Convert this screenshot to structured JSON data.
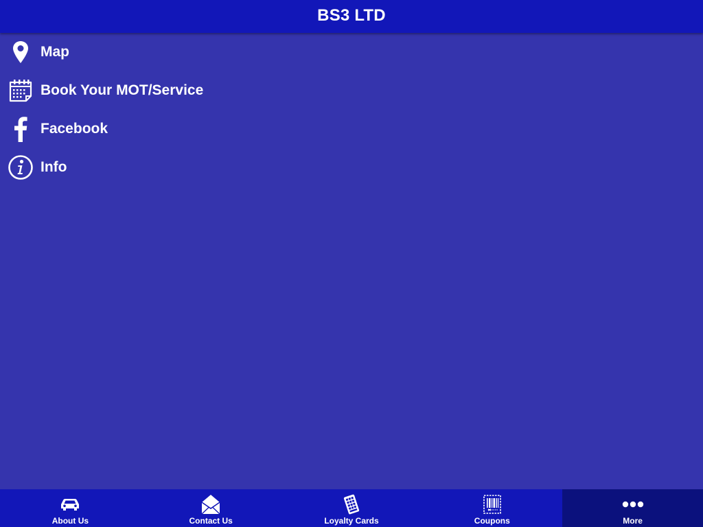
{
  "header": {
    "title": "BS3 LTD"
  },
  "menu": {
    "items": [
      {
        "label": "Map",
        "icon": "map-pin-icon"
      },
      {
        "label": "Book Your MOT/Service",
        "icon": "calendar-icon"
      },
      {
        "label": "Facebook",
        "icon": "facebook-icon"
      },
      {
        "label": "Info",
        "icon": "info-icon"
      }
    ]
  },
  "tabbar": {
    "tabs": [
      {
        "label": "About Us",
        "icon": "car-icon",
        "active": false
      },
      {
        "label": "Contact Us",
        "icon": "envelope-icon",
        "active": false
      },
      {
        "label": "Loyalty Cards",
        "icon": "loyalty-card-icon",
        "active": false
      },
      {
        "label": "Coupons",
        "icon": "coupon-barcode-icon",
        "active": false
      },
      {
        "label": "More",
        "icon": "more-dots-icon",
        "active": true
      }
    ]
  },
  "colors": {
    "header_bg": "#1217b8",
    "content_bg": "#3534ad",
    "tabbar_bg": "#1217b8",
    "active_tab_bg": "#0b117d",
    "text": "#ffffff"
  }
}
